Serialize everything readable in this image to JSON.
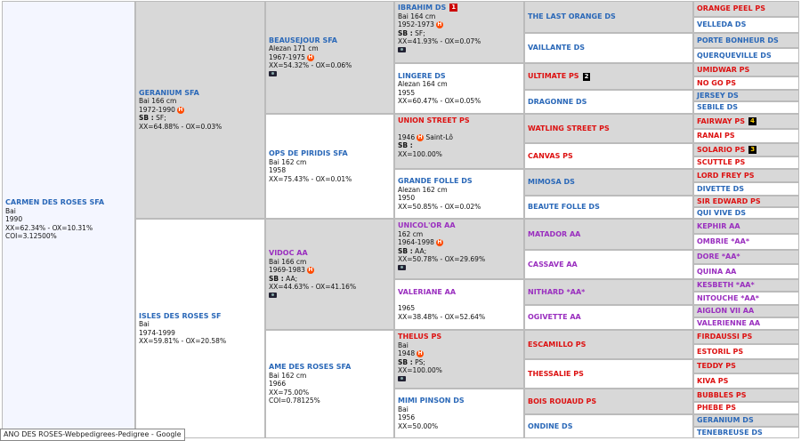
{
  "tooltip": "ANO DES ROSES-Webpedigrees-Pedigree - Google",
  "g1": {
    "name": "CARMEN DES ROSES SFA",
    "l1": "Bai",
    "l2": "1990",
    "l3": "XX=62.34% - OX=10.31%",
    "l4": "COI=3.12500%"
  },
  "g2": [
    {
      "name": "GERANIUM SFA",
      "l1": "Bai  166 cm",
      "l2": "1972-1990",
      "sb": "SB :",
      "sbv": " SF;",
      "l4": "XX=64.88% - OX=0.03%"
    },
    {
      "name": "ISLES DES ROSES SF",
      "l1": "Bai",
      "l2": "1974-1999",
      "l3": "XX=59.81% - OX=20.58%"
    }
  ],
  "g3": [
    {
      "name": "BEAUSEJOUR SFA",
      "l1": "Alezan  171 cm",
      "l2": "1967-1975",
      "l3": "XX=54.32% - OX=0.06%"
    },
    {
      "name": "OPS DE PIRIDIS SFA",
      "l1": "Bai  162 cm",
      "l2": "1958",
      "l3": "XX=75.43% - OX=0.01%"
    },
    {
      "name": "VIDOC AA",
      "l1": "Bai  166 cm",
      "l2": "1969-1983",
      "sb": "SB :",
      "sbv": " AA;",
      "l4": "XX=44.63% - OX=41.16%"
    },
    {
      "name": "AME DES ROSES SFA",
      "l1": "Bai  162 cm",
      "l2": "1966",
      "l3": "XX=75.00%",
      "l4": "COI=0.78125%"
    }
  ],
  "g4": [
    {
      "name": "IBRAHIM DS",
      "badge": "1",
      "l1": "Bai  164 cm",
      "l2": "1952-1973",
      "sb": "SB :",
      "sbv": " SF;",
      "l4": "XX=41.93% - OX=0.07%"
    },
    {
      "name": "LINGERE DS",
      "l1": "Alezan  164 cm",
      "l2": "1955",
      "l3": "XX=60.47% - OX=0.05%"
    },
    {
      "name": "UNION STREET PS",
      "l2": "1946",
      "place": "Saint-Lô",
      "sb": "SB :",
      "l4": "XX=100.00%"
    },
    {
      "name": "GRANDE FOLLE DS",
      "l1": "Alezan  162 cm",
      "l2": "1950",
      "l3": "XX=50.85% - OX=0.02%"
    },
    {
      "name": "UNICOL'OR AA",
      "l1": " 162 cm",
      "l2": "1964-1998",
      "sb": "SB :",
      "sbv": " AA;",
      "l4": "XX=50.78% - OX=29.69%"
    },
    {
      "name": "VALERIANE AA",
      "l2": "1965",
      "l3": "XX=38.48% - OX=52.64%"
    },
    {
      "name": "THELUS PS",
      "l1": "Bai",
      "l2": "1948",
      "sb": "SB :",
      "sbv": " PS;",
      "l4": "XX=100.00%"
    },
    {
      "name": "MIMI PINSON DS",
      "l1": "Bai",
      "l2": "1956",
      "l3": "XX=50.00%"
    }
  ],
  "g5": [
    {
      "name": "THE LAST ORANGE DS"
    },
    {
      "name": "VAILLANTE DS"
    },
    {
      "name": "ULTIMATE PS",
      "badge": "2"
    },
    {
      "name": "DRAGONNE DS"
    },
    {
      "name": "WATLING STREET PS"
    },
    {
      "name": "CANVAS PS"
    },
    {
      "name": "MIMOSA DS"
    },
    {
      "name": "BEAUTE FOLLE DS"
    },
    {
      "name": "MATADOR AA"
    },
    {
      "name": "CASSAVE AA"
    },
    {
      "name": "NITHARD *AA*"
    },
    {
      "name": "OGIVETTE AA"
    },
    {
      "name": "ESCAMILLO PS"
    },
    {
      "name": "THESSALIE PS"
    },
    {
      "name": "BOIS ROUAUD PS"
    },
    {
      "name": "ONDINE DS"
    }
  ],
  "g6": [
    {
      "name": "ORANGE PEEL PS"
    },
    {
      "name": "VELLEDA DS"
    },
    {
      "name": "PORTE BONHEUR DS"
    },
    {
      "name": "QUERQUEVILLE DS"
    },
    {
      "name": "UMIDWAR PS"
    },
    {
      "name": "NO GO PS"
    },
    {
      "name": "JERSEY DS"
    },
    {
      "name": "SEBILE DS"
    },
    {
      "name": "FAIRWAY PS",
      "badge": "4"
    },
    {
      "name": "RANAI PS"
    },
    {
      "name": "SOLARIO PS",
      "badge": "3"
    },
    {
      "name": "SCUTTLE PS"
    },
    {
      "name": "LORD FREY PS"
    },
    {
      "name": "DIVETTE DS"
    },
    {
      "name": "SIR EDWARD PS"
    },
    {
      "name": "QUI VIVE DS"
    },
    {
      "name": "KEPHIR AA"
    },
    {
      "name": "OMBRIE *AA*"
    },
    {
      "name": "DORE *AA*"
    },
    {
      "name": "QUINA AA"
    },
    {
      "name": "KESBETH *AA*"
    },
    {
      "name": "NITOUCHE *AA*"
    },
    {
      "name": "AIGLON VII AA"
    },
    {
      "name": "VALERIENNE AA"
    },
    {
      "name": "FIRDAUSSI PS"
    },
    {
      "name": "ESTORIL PS"
    },
    {
      "name": "TEDDY PS"
    },
    {
      "name": "KIVA PS"
    },
    {
      "name": "BUBBLES PS"
    },
    {
      "name": "PHEBE PS"
    },
    {
      "name": "GERANIUM DS"
    },
    {
      "name": "TENEBREUSE DS"
    }
  ]
}
